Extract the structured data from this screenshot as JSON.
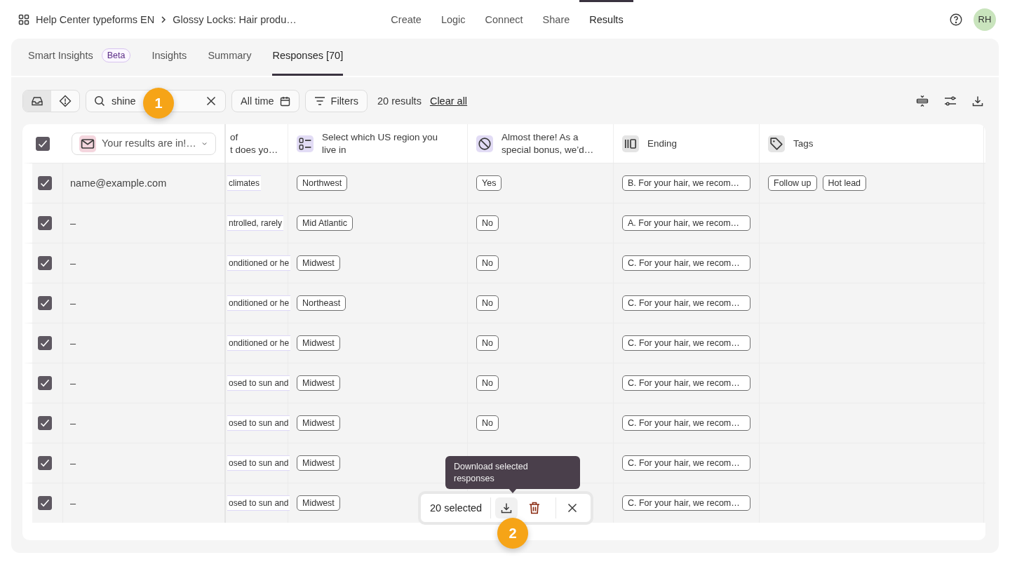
{
  "breadcrumb": {
    "workspace": "Help Center typeforms EN",
    "form": "Glossy Locks: Hair produ…"
  },
  "nav": [
    {
      "label": "Create",
      "selected": false
    },
    {
      "label": "Logic",
      "selected": false
    },
    {
      "label": "Connect",
      "selected": false
    },
    {
      "label": "Share",
      "selected": false
    },
    {
      "label": "Results",
      "selected": true
    }
  ],
  "user": {
    "initials": "RH"
  },
  "tabs": [
    {
      "label": "Smart Insights",
      "badge": "Beta",
      "selected": false
    },
    {
      "label": "Insights",
      "selected": false
    },
    {
      "label": "Summary",
      "selected": false
    },
    {
      "label": "Responses [70]",
      "selected": true
    }
  ],
  "toolbar": {
    "views": [
      {
        "kind": "inbox",
        "selected": true
      },
      {
        "kind": "alert",
        "selected": false
      }
    ],
    "search": {
      "value": "shine"
    },
    "date_filter": "All time",
    "filters": "Filters",
    "result_count": "20 results",
    "clear": "Clear all"
  },
  "table": {
    "all_checked": true,
    "columns": [
      {
        "kind": "email",
        "label": "Your results are in!…"
      },
      {
        "kind": "partial",
        "lines": [
          "of",
          "t does yo…"
        ]
      },
      {
        "kind": "choice",
        "label": "Select which US region you live in"
      },
      {
        "kind": "yesno",
        "label": "Almost there! As a special bonus, we’d…"
      },
      {
        "kind": "ending",
        "label": "Ending"
      },
      {
        "kind": "tags",
        "label": "Tags"
      }
    ],
    "rows": [
      {
        "checked": true,
        "email": "name@example.com",
        "partial": "climates",
        "region": "Northwest",
        "answer": "Yes",
        "ending": "B. For your hair, we recom…",
        "tags": [
          "Follow up",
          "Hot lead"
        ]
      },
      {
        "checked": true,
        "email": "–",
        "partial": "ntrolled, rarely",
        "region": "Mid Atlantic",
        "answer": "No",
        "ending": "A. For your hair, we recom…"
      },
      {
        "checked": true,
        "email": "–",
        "partial": "onditioned or he",
        "region": "Midwest",
        "answer": "No",
        "ending": "C. For your hair, we recom…"
      },
      {
        "checked": true,
        "email": "–",
        "partial": "onditioned or he",
        "region": "Northeast",
        "answer": "No",
        "ending": "C. For your hair, we recom…"
      },
      {
        "checked": true,
        "email": "–",
        "partial": "onditioned or he",
        "region": "Midwest",
        "answer": "No",
        "ending": "C. For your hair, we recom…"
      },
      {
        "checked": true,
        "email": "–",
        "partial": "osed to sun and",
        "region": "Midwest",
        "answer": "No",
        "ending": "C. For your hair, we recom…"
      },
      {
        "checked": true,
        "email": "–",
        "partial": "osed to sun and",
        "region": "Midwest",
        "answer": "No",
        "ending": "C. For your hair, we recom…"
      },
      {
        "checked": true,
        "email": "–",
        "partial": "osed to sun and",
        "region": "Midwest",
        "ending": "C. For your hair, we recom…"
      },
      {
        "checked": true,
        "email": "–",
        "partial": "osed to sun and",
        "region": "Midwest",
        "ending": "C. For your hair, we recom…"
      }
    ]
  },
  "selection_bar": {
    "count": "20 selected",
    "tooltip": "Download selected responses"
  },
  "step_markers": [
    "1",
    "2"
  ]
}
